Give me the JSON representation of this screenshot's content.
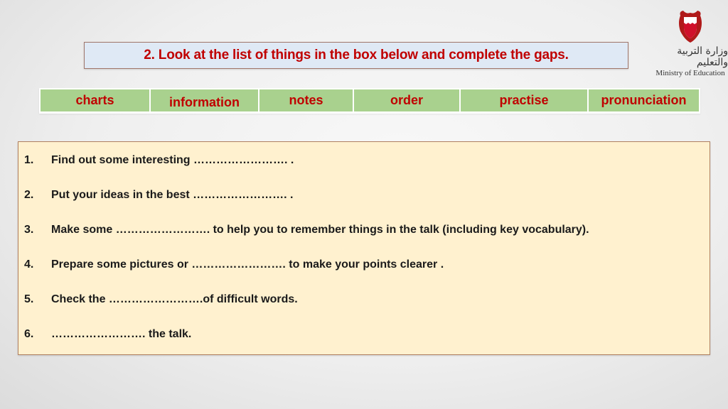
{
  "title": "2. Look at the list of things in the box below and complete the gaps.",
  "logo": {
    "arabic_text": "وزارة التربية والتعليم",
    "english_text": "Ministry of Education"
  },
  "word_bank": [
    "charts",
    "information",
    "notes",
    "order",
    "practise",
    "pronunciation"
  ],
  "items": [
    {
      "number": "1.",
      "text": "Find out some interesting ……………………. ."
    },
    {
      "number": "2.",
      "text": "Put your ideas in the best ……………………. ."
    },
    {
      "number": "3.",
      "text": "Make some ……………………. to help you to remember things in the talk (including key vocabulary)."
    },
    {
      "number": "4.",
      "text": "Prepare some pictures or ……………………. to make your points clearer ."
    },
    {
      "number": "5.",
      "text": "Check the …………………….of difficult words."
    },
    {
      "number": "6.",
      "text": "……………………. the talk."
    }
  ],
  "colors": {
    "title_text": "#c00000",
    "title_bg": "#dfe9f5",
    "word_bank_bg": "#a9d18e",
    "exercise_bg": "#fff1cf"
  }
}
